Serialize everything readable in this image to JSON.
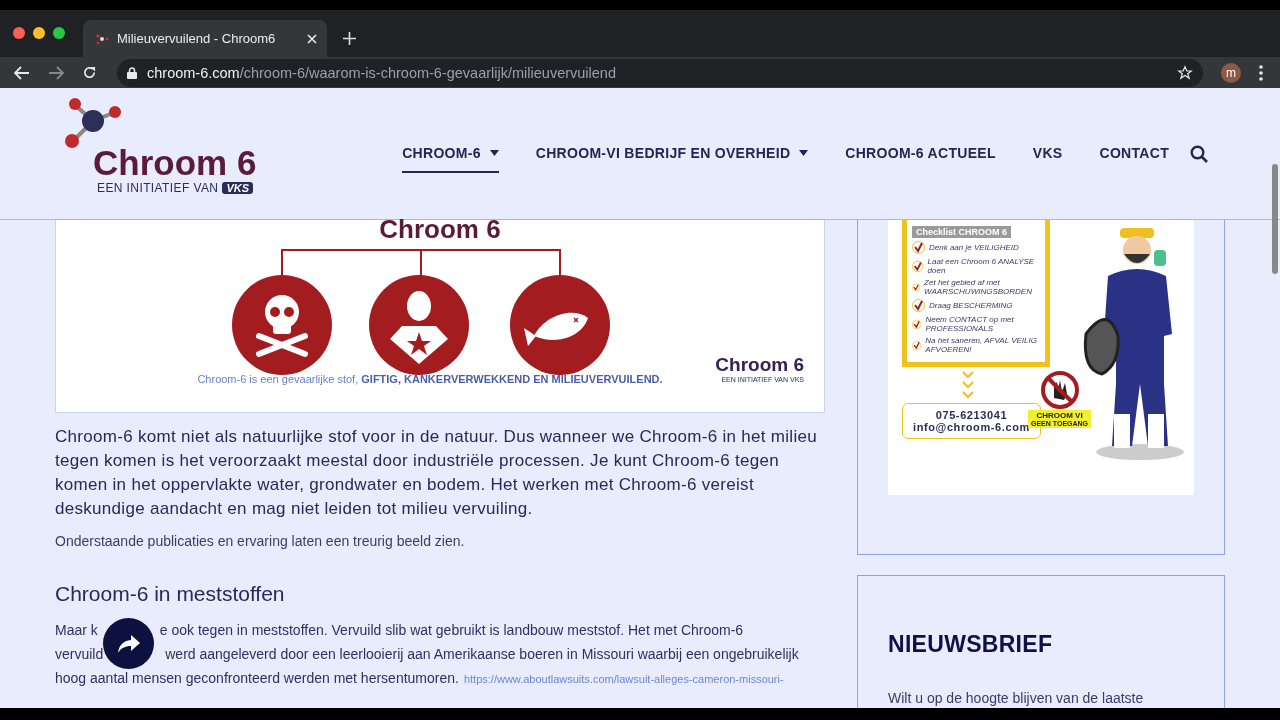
{
  "browser": {
    "tab_title": "Milieuvervuilend - Chroom6",
    "url_host": "chroom-6.com",
    "url_path": "/chroom-6/waarom-is-chroom-6-gevaarlijk/milieuvervuilend",
    "profile_initial": "m"
  },
  "logo": {
    "name": "Chroom 6",
    "tagline": "EEN INITIATIEF VAN",
    "badge": "VKS"
  },
  "nav": [
    {
      "label": "CHROOM-6",
      "has_dropdown": true,
      "selected": true
    },
    {
      "label": "CHROOM-VI BEDRIJF EN OVERHEID",
      "has_dropdown": true,
      "selected": false
    },
    {
      "label": "CHROOM-6 ACTUEEL",
      "has_dropdown": false,
      "selected": false
    },
    {
      "label": "VKS",
      "has_dropdown": false,
      "selected": false
    },
    {
      "label": "CONTACT",
      "has_dropdown": false,
      "selected": false
    }
  ],
  "banner": {
    "title": "Chroom 6",
    "caption": "Chroom-6 is een gevaarlijke stof, **GIFTIG, KANKERVERWEKKEND EN MILIEUVERVUILEND.**",
    "logo_name": "Chroom 6",
    "logo_tagline": "EEN INITIATIEF VAN",
    "logo_badge": "VKS"
  },
  "intro": "Chroom-6 komt niet als natuurlijke stof voor in de natuur. Dus wanneer we Chroom-6 in het milieu tegen komen is het veroorzaakt meestal door industriële processen. Je kunt Chroom-6 tegen komen in het oppervlakte water, grondwater en bodem. Het werken met Chroom-6 vereist deskundige aandacht en mag niet leiden tot milieu vervuiling.",
  "note": "Onderstaande publicaties en ervaring laten een treurig beeld zien.",
  "section": {
    "heading": "Chroom-6 in meststoffen",
    "lines": [
      {
        "before": "Maar k",
        "after": "e ook tegen in meststoffen. Vervuild slib wat gebruikt is landbouw meststof. Het met Chroom-6"
      },
      {
        "before": "vervuild",
        "after": "werd aangeleverd door een leerlooierij aan Amerikaanse boeren in Missouri waarbij een ongebruikelijk"
      },
      {
        "before": "hoog aantal mensen geconfronteerd werden met hersentumoren.",
        "link": "https://www.aboutlawsuits.com/lawsuit-alleges-cameron-missouri-"
      }
    ]
  },
  "infographic": {
    "checklist_title": "Checklist CHROOM 6",
    "items": [
      "Denk aan je VEILIGHEID",
      "Laat een Chroom 6 ANALYSE doen",
      "Zet het gebied af met WAARSCHUWINGSBORDEN",
      "Draag BESCHERMING",
      "Neem CONTACT op met PROFESSIONALS",
      "Na het saneren, AFVAL VEILIG AFVOEREN!"
    ],
    "sign_title": "CHROOM VI",
    "sign_subtitle": "GEEN TOEGANG",
    "phone": "075-6213041",
    "email": "info@chroom-6.com"
  },
  "newsletter": {
    "heading": "NIEUWSBRIEF",
    "text": "Wilt u op de hoogte blijven van de laatste"
  }
}
